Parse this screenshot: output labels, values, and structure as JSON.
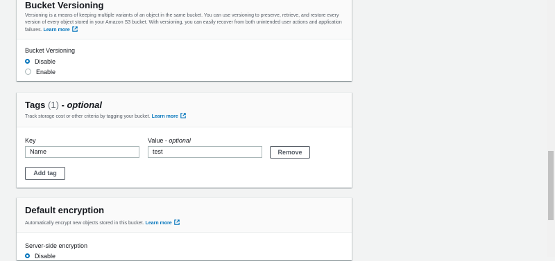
{
  "versioning": {
    "title": "Bucket Versioning",
    "description": "Versioning is a means of keeping multiple variants of an object in the same bucket. You can use versioning to preserve, retrieve, and restore every version of every object stored in your Amazon S3 bucket. With versioning, you can easily recover from both unintended user actions and application failures.",
    "learn_more": "Learn more",
    "field_label": "Bucket Versioning",
    "options": [
      "Disable",
      "Enable"
    ],
    "selected": "Disable"
  },
  "tags": {
    "title": "Tags",
    "count": "(1)",
    "dash": " - ",
    "optional": "optional",
    "description": "Track storage cost or other criteria by tagging your bucket.",
    "learn_more": "Learn more",
    "key_label": "Key",
    "value_label": "Value - ",
    "value_optional": "optional",
    "key_value": "Name",
    "value_value": "test",
    "remove_label": "Remove",
    "add_tag_label": "Add tag"
  },
  "encryption": {
    "title": "Default encryption",
    "description": "Automatically encrypt new objects stored in this bucket.",
    "learn_more": "Learn more",
    "field_label": "Server-side encryption",
    "options": [
      "Disable"
    ],
    "selected": "Disable"
  },
  "colors": {
    "link": "#0073bb",
    "radio_selected": "#0073bb",
    "background": "#f2f3f3"
  },
  "icons": {
    "external_link": "external-link-icon"
  }
}
